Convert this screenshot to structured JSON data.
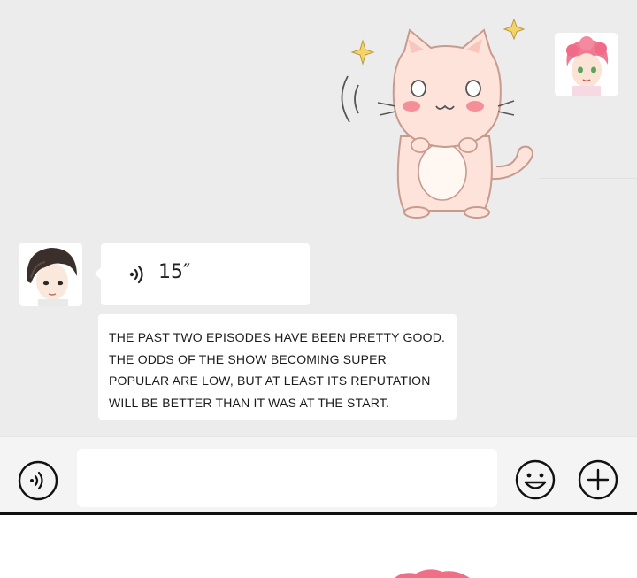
{
  "chat": {
    "messages": [
      {
        "sender": "right",
        "type": "sticker",
        "sticker": "waving-cat-sticker"
      },
      {
        "sender": "left",
        "type": "voice",
        "duration": "15″"
      },
      {
        "sender": "left",
        "type": "text",
        "text": "THE PAST TWO EPISODES HAVE BEEN PRETTY GOOD. THE ODDS OF THE SHOW BECOMING SUPER POPULAR ARE LOW, BUT AT LEAST ITS REPUTATION WILL BE BETTER THAN IT WAS AT THE START."
      }
    ]
  },
  "input_bar": {
    "input_value": "",
    "icons": [
      "voice-toggle-icon",
      "emoji-icon",
      "plus-icon"
    ]
  },
  "colors": {
    "chat_background": "#ececec",
    "bubble": "#ffffff",
    "input_bar": "#f4f4f4",
    "icon_stroke": "#111111",
    "cat_body": "#fbd9cf",
    "cat_cheeks": "#f48f9a",
    "sparkle": "#d9b64a"
  }
}
